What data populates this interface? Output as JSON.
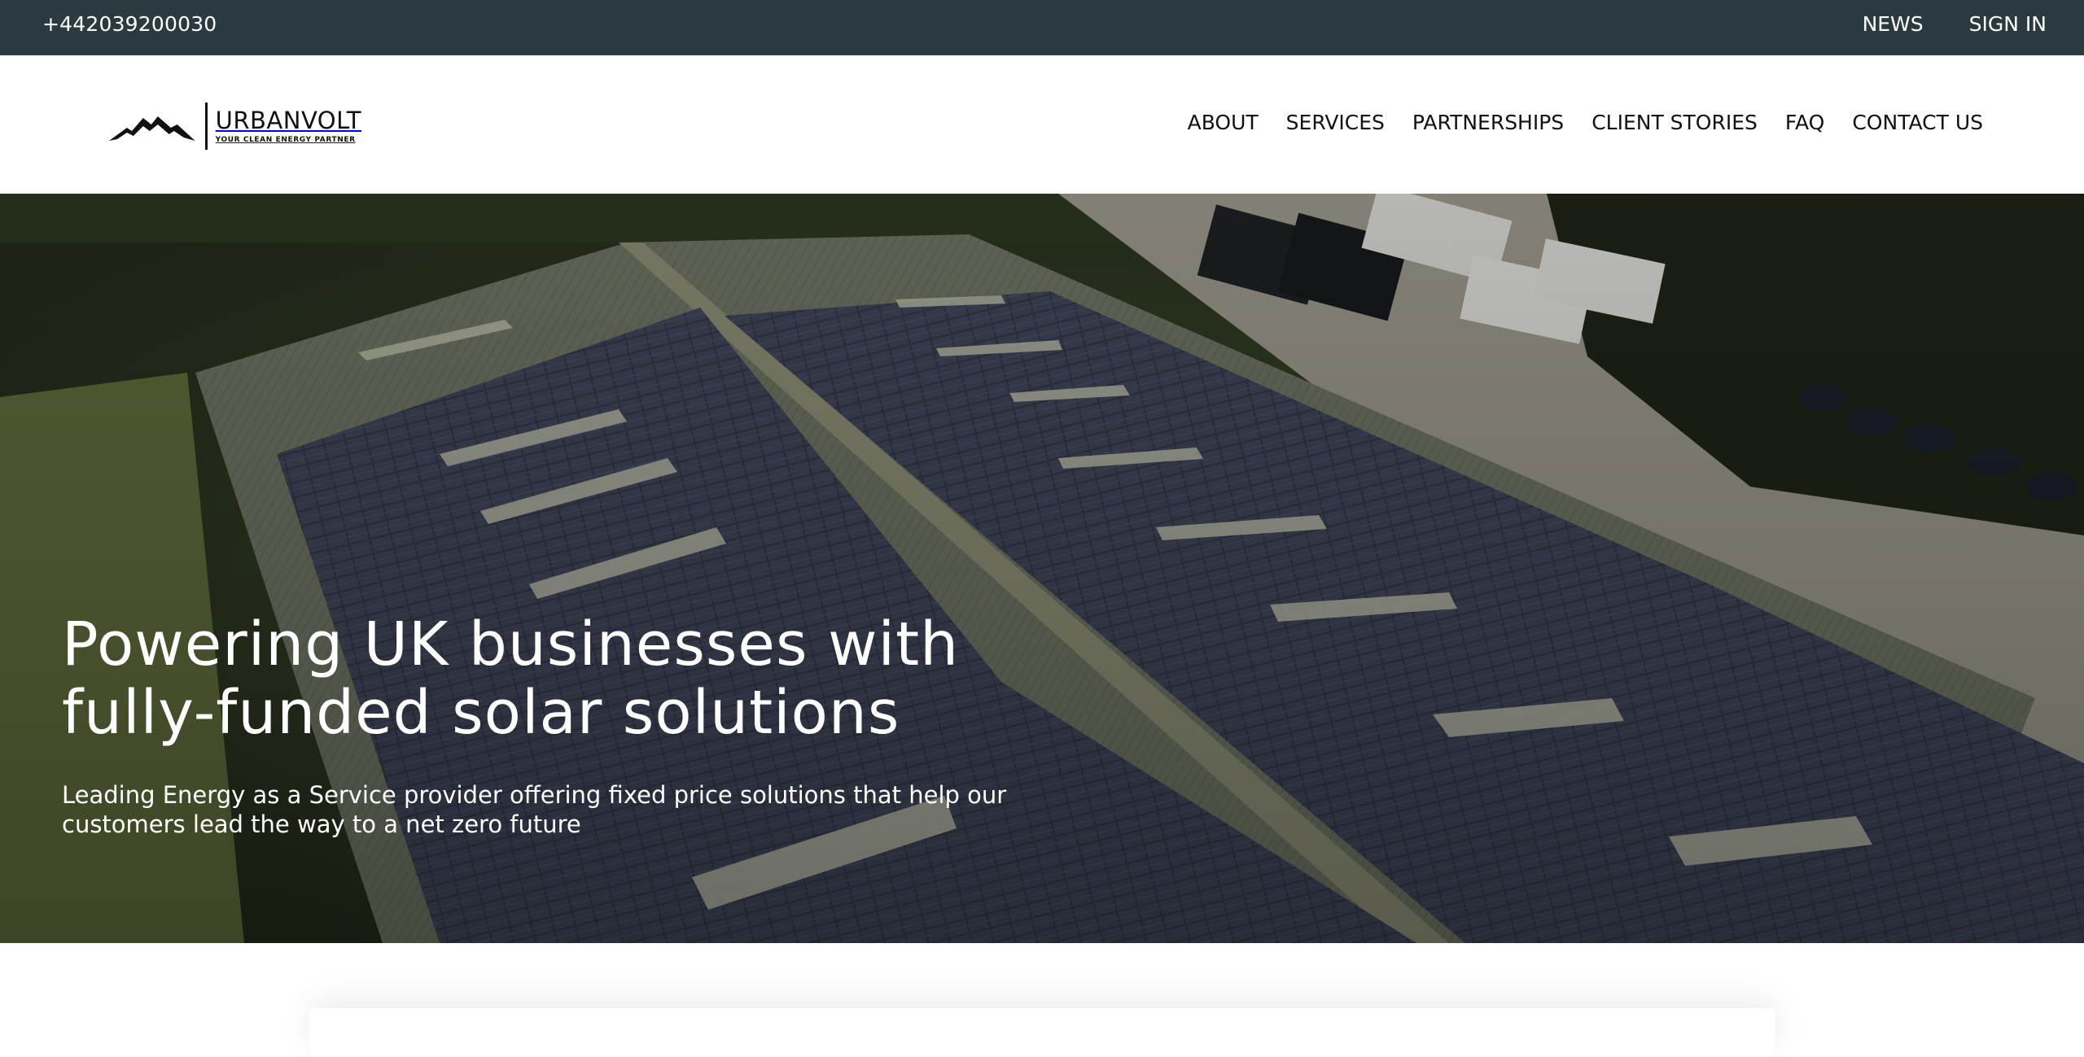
{
  "topbar": {
    "phone": "+442039200030",
    "links": [
      "NEWS",
      "SIGN IN"
    ]
  },
  "header": {
    "logo": {
      "brand": "URBANVOLT",
      "tagline": "YOUR CLEAN ENERGY PARTNER",
      "icon": "mountain-logo-icon"
    },
    "nav": [
      "ABOUT",
      "SERVICES",
      "PARTNERSHIPS",
      "CLIENT STORIES",
      "FAQ",
      "CONTACT US"
    ]
  },
  "hero": {
    "headline_line1": "Powering UK businesses with",
    "headline_line2": "fully-funded solar solutions",
    "subline_line1": "Leading Energy as a Service provider offering fixed price solutions that help our",
    "subline_line2": "customers lead the way to a net zero future"
  },
  "colors": {
    "topbar_bg": "#2b3a40",
    "text_light": "#ffffff",
    "text_dark": "#111111"
  }
}
